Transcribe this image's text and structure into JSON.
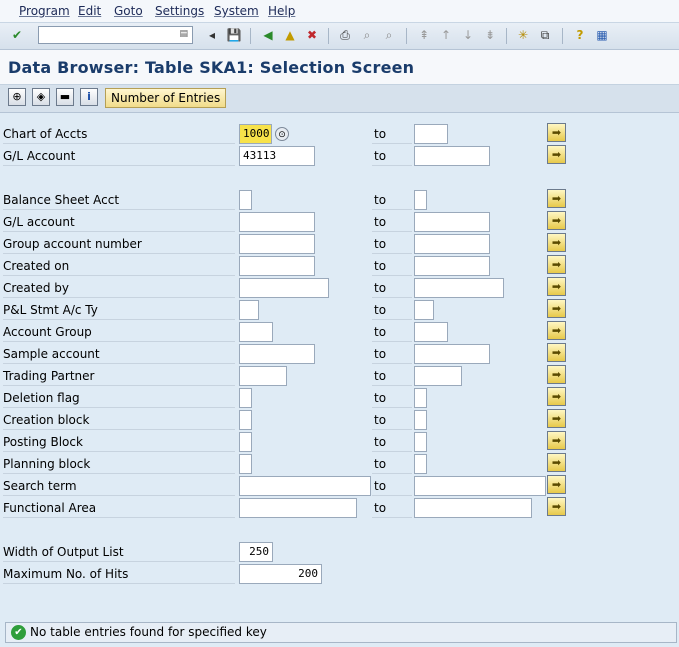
{
  "menu": [
    "Program",
    "Edit",
    "Goto",
    "Settings",
    "System",
    "Help"
  ],
  "toolbar": {
    "command_value": "",
    "icons": [
      "enter-icon",
      "back-icon",
      "save-icon",
      "exit-icon",
      "up-icon",
      "cancel-icon",
      "print-icon",
      "find-icon",
      "find-next-icon",
      "first-page-icon",
      "prev-page-icon",
      "next-page-icon",
      "last-page-icon",
      "new-session-icon",
      "shortcut-icon",
      "help-icon",
      "layout-icon"
    ]
  },
  "title": "Data Browser: Table SKA1: Selection Screen",
  "app_toolbar": {
    "number_of_entries": "Number of Entries"
  },
  "to_label": "to",
  "rows": [
    {
      "label": "Chart of Accts",
      "from": "1000",
      "to": ""
    },
    {
      "label": "G/L Account",
      "from": "43113",
      "to": ""
    },
    {
      "label": "Balance Sheet Acct",
      "from": "",
      "to": ""
    },
    {
      "label": "G/L account",
      "from": "",
      "to": ""
    },
    {
      "label": "Group account number",
      "from": "",
      "to": ""
    },
    {
      "label": "Created on",
      "from": "",
      "to": ""
    },
    {
      "label": "Created by",
      "from": "",
      "to": ""
    },
    {
      "label": "P&L Stmt A/c Ty",
      "from": "",
      "to": ""
    },
    {
      "label": "Account Group",
      "from": "",
      "to": ""
    },
    {
      "label": "Sample account",
      "from": "",
      "to": ""
    },
    {
      "label": "Trading Partner",
      "from": "",
      "to": ""
    },
    {
      "label": "Deletion flag",
      "from": "",
      "to": ""
    },
    {
      "label": "Creation block",
      "from": "",
      "to": ""
    },
    {
      "label": "Posting Block",
      "from": "",
      "to": ""
    },
    {
      "label": "Planning block",
      "from": "",
      "to": ""
    },
    {
      "label": "Search term",
      "from": "",
      "to": ""
    },
    {
      "label": "Functional Area",
      "from": "",
      "to": ""
    }
  ],
  "output": {
    "width_label": "Width of Output List",
    "width_value": "250",
    "max_hits_label": "Maximum No. of Hits",
    "max_hits_value": "200"
  },
  "status": {
    "message": "No table entries found for specified key"
  }
}
